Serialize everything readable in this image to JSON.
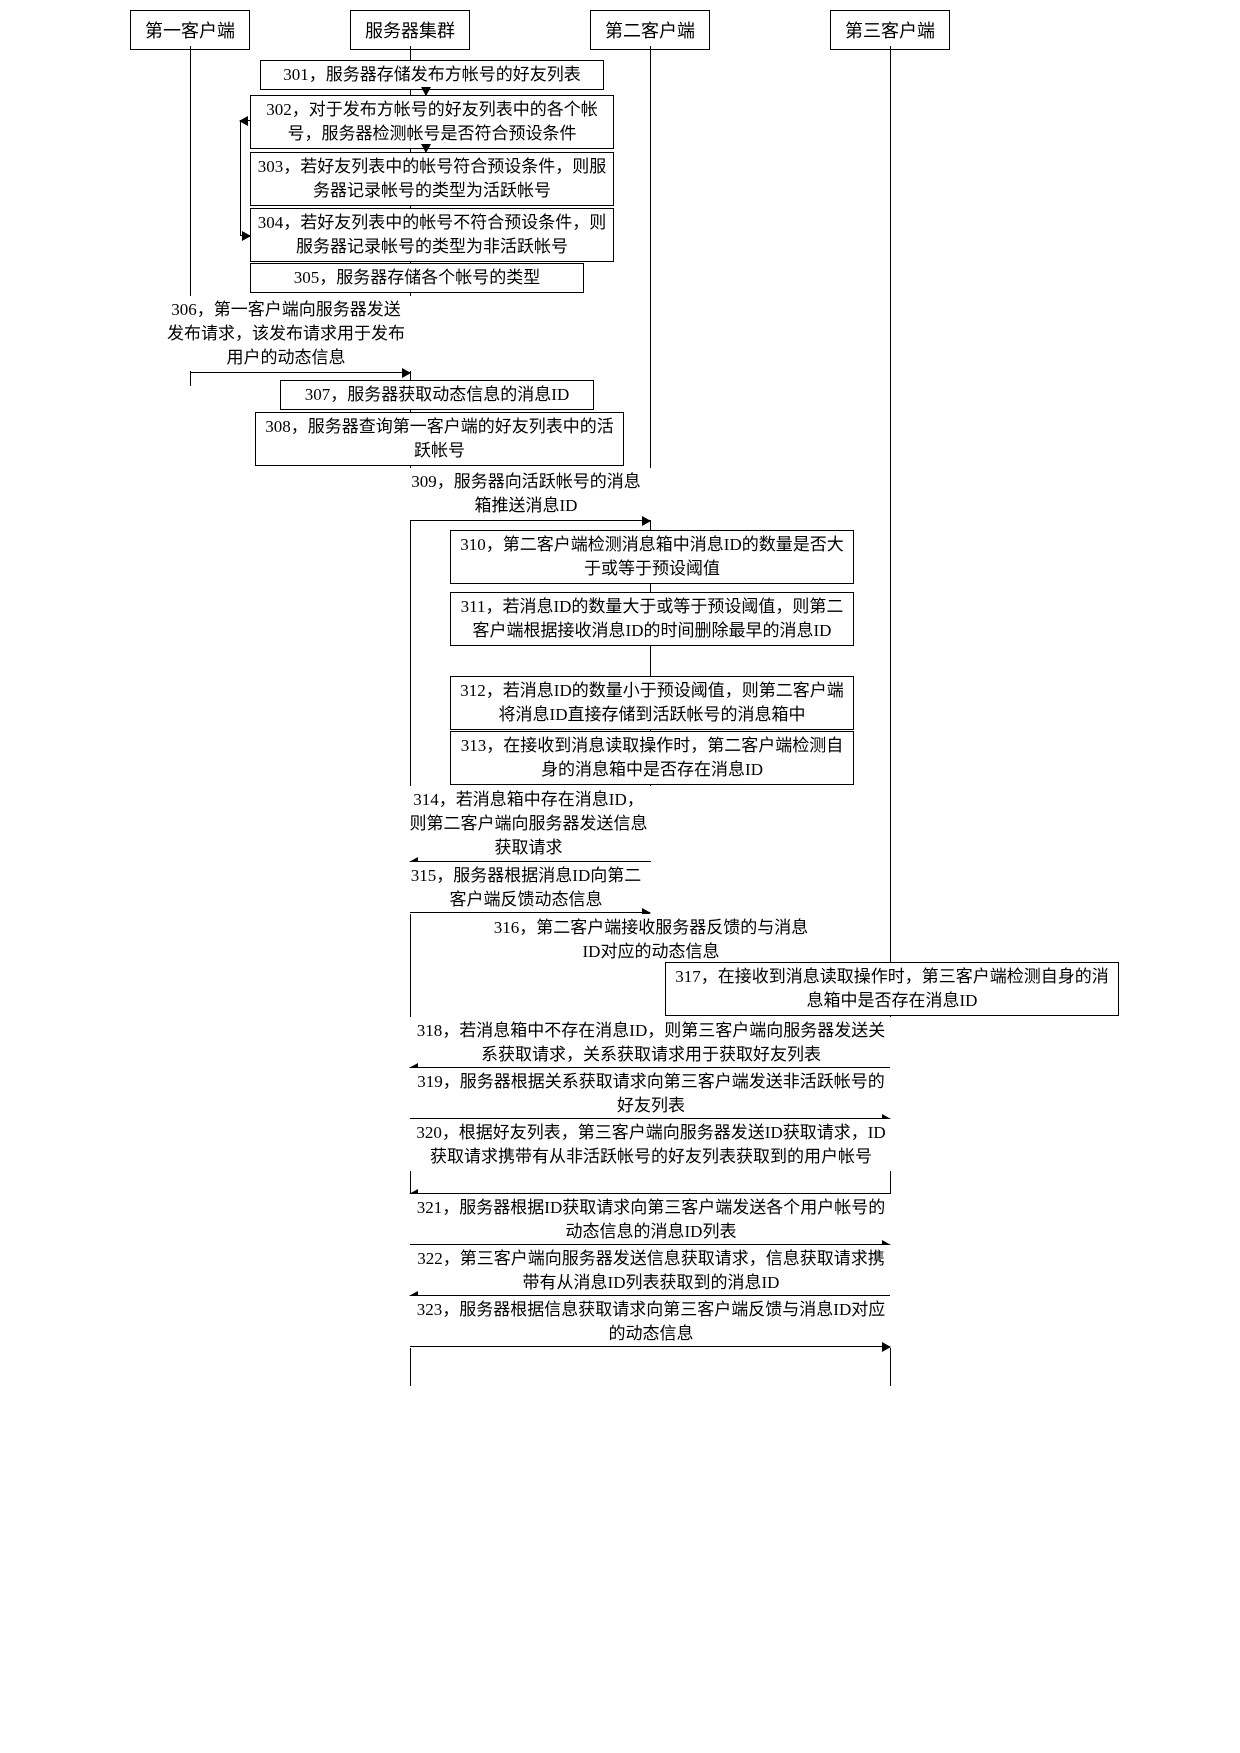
{
  "actors": {
    "client1": "第一客户端",
    "server": "服务器集群",
    "client2": "第二客户端",
    "client3": "第三客户端"
  },
  "steps": {
    "s301": "301，服务器存储发布方帐号的好友列表",
    "s302": "302，对于发布方帐号的好友列表中的各个帐号，服务器检测帐号是否符合预设条件",
    "s303": "303，若好友列表中的帐号符合预设条件，则服务器记录帐号的类型为活跃帐号",
    "s304": "304，若好友列表中的帐号不符合预设条件，则服务器记录帐号的类型为非活跃帐号",
    "s305": "305，服务器存储各个帐号的类型",
    "s306": "306，第一客户端向服务器发送发布请求，该发布请求用于发布用户的动态信息",
    "s307": "307，服务器获取动态信息的消息ID",
    "s308": "308，服务器查询第一客户端的好友列表中的活跃帐号",
    "s309": "309，服务器向活跃帐号的消息箱推送消息ID",
    "s310": "310，第二客户端检测消息箱中消息ID的数量是否大于或等于预设阈值",
    "s311": "311，若消息ID的数量大于或等于预设阈值，则第二客户端根据接收消息ID的时间删除最早的消息ID",
    "s312": "312，若消息ID的数量小于预设阈值，则第二客户端将消息ID直接存储到活跃帐号的消息箱中",
    "s313": "313，在接收到消息读取操作时，第二客户端检测自身的消息箱中是否存在消息ID",
    "s314": "314，若消息箱中存在消息ID，则第二客户端向服务器发送信息获取请求",
    "s315": "315，服务器根据消息ID向第二客户端反馈动态信息",
    "s316": "316，第二客户端接收服务器反馈的与消息ID对应的动态信息",
    "s317": "317，在接收到消息读取操作时，第三客户端检测自身的消息箱中是否存在消息ID",
    "s318": "318，若消息箱中不存在消息ID，则第三客户端向服务器发送关系获取请求，关系获取请求用于获取好友列表",
    "s319": "319，服务器根据关系获取请求向第三客户端发送非活跃帐号的好友列表",
    "s320": "320，根据好友列表，第三客户端向服务器发送ID获取请求，ID获取请求携带有从非活跃帐号的好友列表获取到的用户帐号",
    "s321": "321，服务器根据ID获取请求向第三客户端发送各个用户帐号的动态信息的消息ID列表",
    "s322": "322，第三客户端向服务器发送信息获取请求，信息获取请求携带有从消息ID列表获取到的消息ID",
    "s323": "323，服务器根据信息获取请求向第三客户端反馈与消息ID对应的动态信息"
  }
}
